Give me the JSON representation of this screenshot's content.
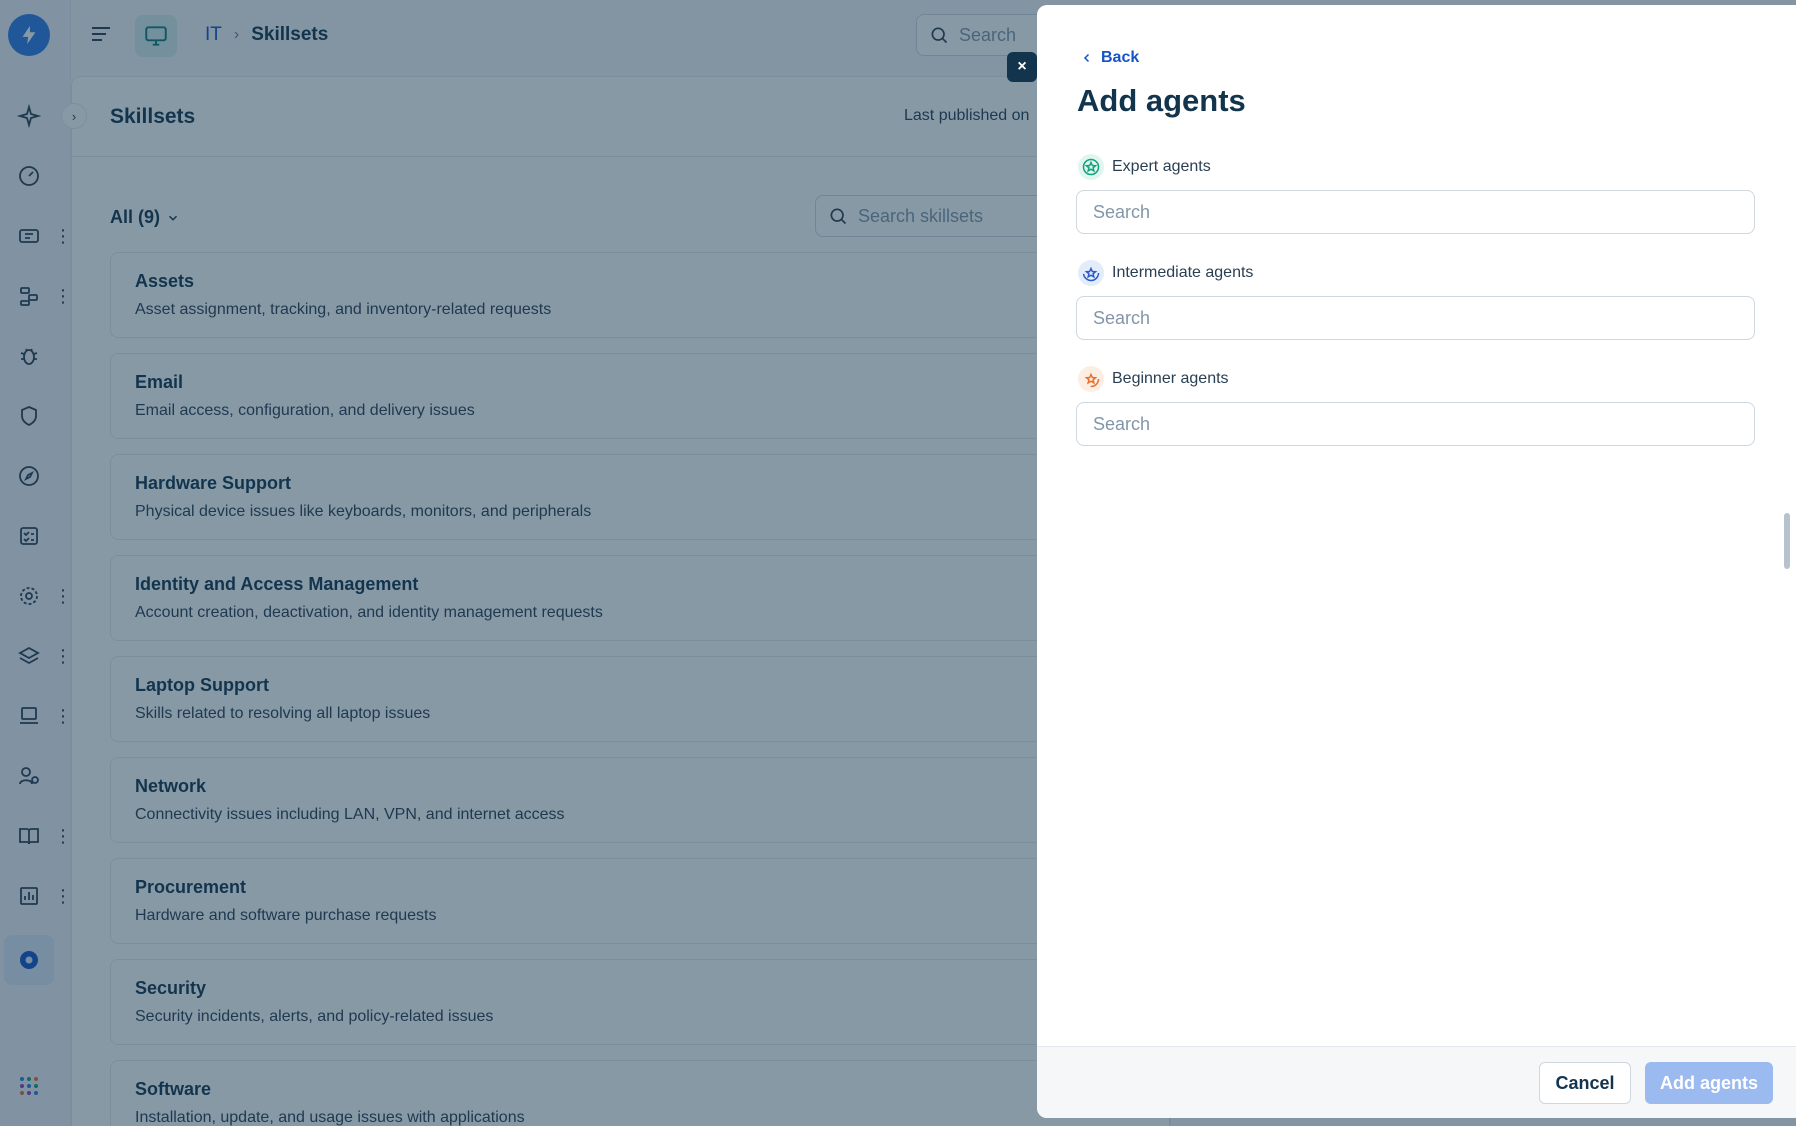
{
  "breadcrumb": {
    "workspace": "IT",
    "current": "Skillsets"
  },
  "top_search": {
    "placeholder": "Search"
  },
  "page": {
    "title": "Skillsets",
    "last_published": "Last published on",
    "filter_label": "All (9)",
    "search_placeholder": "Search skillsets"
  },
  "skillsets": [
    {
      "title": "Assets",
      "description": "Asset assignment, tracking, and inventory-related requests"
    },
    {
      "title": "Email",
      "description": "Email access, configuration, and delivery issues"
    },
    {
      "title": "Hardware Support",
      "description": "Physical device issues like keyboards, monitors, and peripherals"
    },
    {
      "title": "Identity and Access Management",
      "description": "Account creation, deactivation, and identity management requests"
    },
    {
      "title": "Laptop Support",
      "description": "Skills related to resolving all laptop issues"
    },
    {
      "title": "Network",
      "description": "Connectivity issues including LAN, VPN, and internet access"
    },
    {
      "title": "Procurement",
      "description": "Hardware and software purchase requests"
    },
    {
      "title": "Security",
      "description": "Security incidents, alerts, and policy-related issues"
    },
    {
      "title": "Software",
      "description": "Installation, update, and usage issues with applications"
    }
  ],
  "drawer": {
    "close_label": "×",
    "back_label": "Back",
    "title": "Add agents",
    "groups": [
      {
        "label": "Expert agents",
        "placeholder": "Search",
        "icon_color": "#10a37f"
      },
      {
        "label": "Intermediate agents",
        "placeholder": "Search",
        "icon_color": "#2c5cc5"
      },
      {
        "label": "Beginner agents",
        "placeholder": "Search",
        "icon_color": "#e8702a"
      }
    ],
    "cancel_label": "Cancel",
    "submit_label": "Add agents"
  },
  "colors": {
    "primary": "#1554c4",
    "submit_disabled": "#9bbaf0",
    "overlay": "#12344d"
  }
}
